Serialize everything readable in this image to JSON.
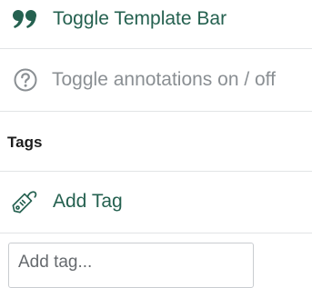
{
  "panel": {
    "template_bar": {
      "label": "Toggle Template Bar",
      "icon": "quote-icon"
    },
    "annotations": {
      "label": "Toggle annotations on / off",
      "icon": "help-circle-icon"
    },
    "tags": {
      "heading": "Tags",
      "add_label": "Add Tag",
      "add_icon": "tag-icon",
      "input_placeholder": "Add tag..."
    }
  },
  "colors": {
    "action": "#256150",
    "muted": "#8a8f93",
    "divider": "#e2e4e6"
  }
}
